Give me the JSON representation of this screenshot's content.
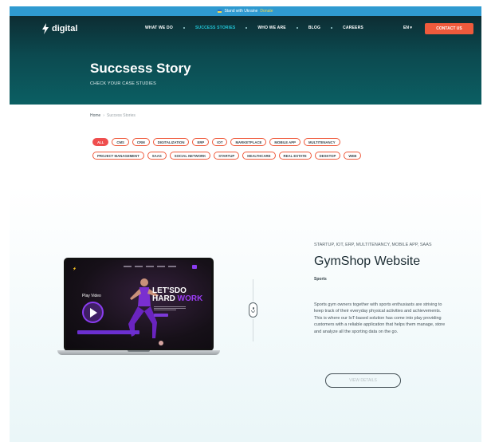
{
  "banner": {
    "text": "Stand with Ukraine",
    "link": "Donate"
  },
  "brand": {
    "logo_text": "digital"
  },
  "nav": {
    "items": [
      {
        "label": "WHAT WE DO",
        "active": false
      },
      {
        "label": "SUCCESS STORIES",
        "active": true
      },
      {
        "label": "WHO WE ARE",
        "active": false
      },
      {
        "label": "BLOG",
        "active": false
      },
      {
        "label": "CAREERS",
        "active": false
      }
    ],
    "language": "EN ▾",
    "contact_label": "CONTACT US"
  },
  "hero": {
    "title": "Succsess Story",
    "subtitle": "CHECK YOUR CASE STUDIES"
  },
  "breadcrumb": {
    "home": "Home",
    "separator": "›",
    "current": "Success Stories"
  },
  "filters": {
    "row1": [
      "ALL",
      "CMS",
      "CRM",
      "DIGITALIZATION",
      "ERP",
      "IOT",
      "MARKETPLACE",
      "MOBILE APP",
      "MULTITENANCY"
    ],
    "row2": [
      "PROJECT MANAGEMENT",
      "SAAS",
      "SOCIAL NETWORK",
      "STARTUP",
      "HEALTHCARE",
      "REAL ESTATE",
      "DESKTOP",
      "WEB"
    ],
    "active": "ALL"
  },
  "case": {
    "tags": "STARTUP, IOT, ERP, MULTITENANCY, MOBILE APP, SAAS",
    "title": "GymShop Website",
    "category": "Sports",
    "description": "Sports gym owners together with sports enthusiasts are striving to keep track of their everyday physical activities and achievements. This is where our IoT-based solution has come into play providing customers with a reliable application that helps them manage, store and analyze all the sporting data on the go.",
    "button_label": "VIEW DETAILS",
    "screen": {
      "play_label": "Play Video",
      "headline_line1": "LET'SDO",
      "headline_line2_a": "HARD ",
      "headline_line2_b": "WORK"
    }
  },
  "colors": {
    "accent": "#ef5a3c",
    "hero_bg": "#0c4a50",
    "active_nav": "#22c7d8",
    "screen_accent": "#8a3cf0"
  }
}
